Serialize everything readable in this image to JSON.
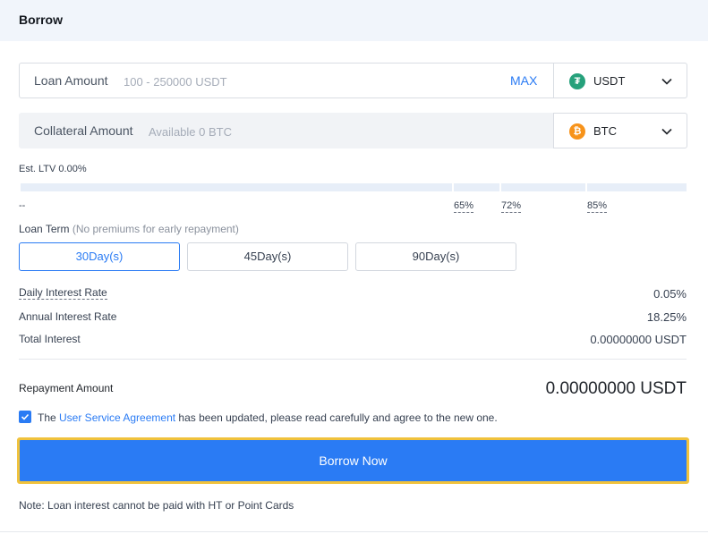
{
  "header": {
    "title": "Borrow"
  },
  "loan": {
    "label": "Loan Amount",
    "placeholder": "100 - 250000 USDT",
    "max_label": "MAX",
    "currency": {
      "symbol": "USDT",
      "icon": "tether-icon",
      "color": "#26a17b",
      "glyph": "₮"
    }
  },
  "collateral": {
    "label": "Collateral Amount",
    "placeholder": "Available 0 BTC",
    "currency": {
      "symbol": "BTC",
      "icon": "bitcoin-icon",
      "color": "#f7931a",
      "glyph": "₿"
    }
  },
  "ltv": {
    "label": "Est. LTV 0.00%",
    "current": "--",
    "thresholds": [
      "65%",
      "72%",
      "85%"
    ]
  },
  "term": {
    "label": "Loan Term",
    "note": "(No premiums for early repayment)",
    "options": [
      "30Day(s)",
      "45Day(s)",
      "90Day(s)"
    ],
    "selected": "30Day(s)"
  },
  "rates": {
    "daily_label": "Daily Interest Rate",
    "daily_value": "0.05%",
    "annual_label": "Annual Interest Rate",
    "annual_value": "18.25%",
    "total_label": "Total Interest",
    "total_value": "0.00000000 USDT"
  },
  "repayment": {
    "label": "Repayment Amount",
    "value": "0.00000000 USDT"
  },
  "agreement": {
    "checked": true,
    "prefix": "The ",
    "link": "User Service Agreement",
    "suffix": " has been updated, please read carefully and agree to the new one."
  },
  "borrow_button": "Borrow Now",
  "footnote": "Note: Loan interest cannot be paid with HT or Point Cards",
  "colors": {
    "accent": "#2a7bf4",
    "highlight": "#f0c23c",
    "header_bg": "#f1f5fb"
  }
}
